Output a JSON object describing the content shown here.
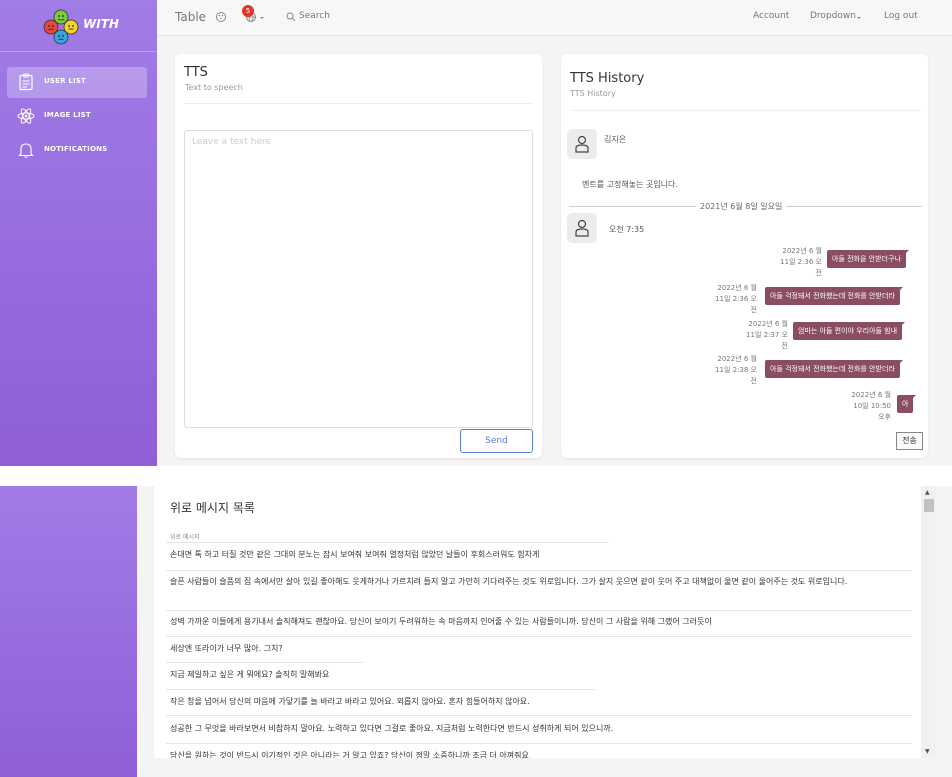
{
  "app": {
    "logo_text": "WITH",
    "brand": "Table"
  },
  "sidebar": {
    "items": [
      {
        "label": "USER LIST",
        "icon": "clipboard-icon",
        "active": true
      },
      {
        "label": "IMAGE LIST",
        "icon": "atom-icon",
        "active": false
      },
      {
        "label": "NOTIFICATIONS",
        "icon": "bell-icon",
        "active": false
      }
    ]
  },
  "topbar": {
    "notification_count": "5",
    "search_label": "Search",
    "account": "Account",
    "dropdown": "Dropdown",
    "logout": "Log out"
  },
  "tts": {
    "title": "TTS",
    "subtitle": "Text to speech",
    "placeholder": "Leave a text here",
    "send": "Send"
  },
  "history": {
    "title": "TTS History",
    "subtitle": "TTS History",
    "first_name": "김지은",
    "pinned": "멘트를 고정해놓는 곳입니다.",
    "date_divider": "2021년 6월 8일 일요일",
    "second_time": "오전 7:35",
    "messages": [
      {
        "text": "아들 전화을 안받더구나",
        "time": "2022년 6 월 11일 2:36 오전"
      },
      {
        "text": "아들 걱정돼서 전화했는데 전화를 안받더라",
        "time": "2022년 6 월 11일 2:36 오전"
      },
      {
        "text": "엄마는 아들 편이야 우리아들 힘내",
        "time": "2022년 6 월 11일 2:37 오전"
      },
      {
        "text": "아들 걱정돼서 전화했는데 전화를 안받더라",
        "time": "2022년 6 월 11일 2:38 오전"
      },
      {
        "text": "아",
        "time": "2022년 6 월 10일 10:50 오후"
      }
    ],
    "transmit": "전송"
  },
  "comfort": {
    "title": "위로 메시지 목록",
    "column": "위로 메시지",
    "rows": [
      "손대면 톡 하고 터질 것만 같은 그대의 분노는 잠시 보여줘 보여줘 열정처럼 않았던 날들이 후회스러워도 힘차게",
      "슬픈 사람들이 슬픔의 집 속에서만 살아 있길 좋아해도 웃게하거나 가르치려 들지 말고 가만히 기다려주는 것도 위로입니다. 그가 살지 웃으면 같이 웃어 주고 대책없이 울면 같이 울어주는 것도 위로입니다.",
      "성벽 가까운 이들에게 용기내서 솔직해져도 괜찮아요. 당신이 보이기 두려워하는 속 마음까지 인어줄 수 있는 사람들이니까. 당신이 그 사람을 위해 그랬어 그러듯이",
      "세상엔 또라이가 너무 많아. 그치?",
      "지금 제일하고 싶은 게 뭐에요? 솔직히 말해봐요",
      "작은 창을 넘어서 당신의 마음에 가닿기를 늘 바라고 바라고 있어요. 외롭지 않아요. 혼자 힘들어하지 않아요.",
      "성공한 그 무엇을 바라보면서 비참하지 말아요. 노력하고 있다면 그걸로 좋아요. 지금처럼 노력한다면 반드시 성취하게 되어 있으니까.",
      "당신을 원하는 것이 반드시 이기적인 것은 아니라는 거 알고 있죠? 당신이 정말 소중하니까 조금 더 아껴줘요"
    ]
  },
  "colors": {
    "sidebar": "#9b6ee0",
    "bubble": "#8a4d63",
    "accent": "#5c7cd4",
    "badge": "#e0352b"
  }
}
